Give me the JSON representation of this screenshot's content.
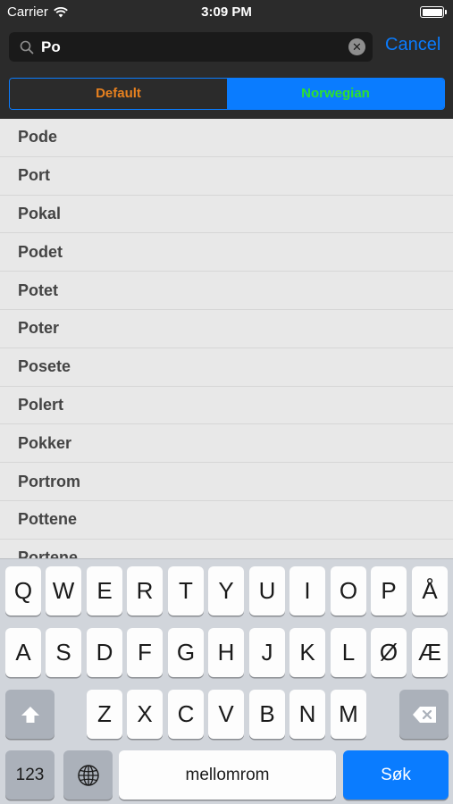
{
  "status_bar": {
    "carrier": "Carrier",
    "time": "3:09 PM"
  },
  "search": {
    "query": "Po",
    "cancel_label": "Cancel"
  },
  "segments": {
    "default_label": "Default",
    "norwegian_label": "Norwegian",
    "selected": "Norwegian"
  },
  "results": [
    "Pode",
    "Port",
    "Pokal",
    "Podet",
    "Potet",
    "Poter",
    "Posete",
    "Polert",
    "Pokker",
    "Portrom",
    "Pottene",
    "Portene"
  ],
  "keyboard": {
    "row1": [
      "Q",
      "W",
      "E",
      "R",
      "T",
      "Y",
      "U",
      "I",
      "O",
      "P",
      "Å"
    ],
    "row2": [
      "A",
      "S",
      "D",
      "F",
      "G",
      "H",
      "J",
      "K",
      "L",
      "Ø",
      "Æ"
    ],
    "row3": [
      "Z",
      "X",
      "C",
      "V",
      "B",
      "N",
      "M"
    ],
    "numbers_label": "123",
    "space_label": "mellomrom",
    "search_label": "Søk"
  },
  "colors": {
    "accent": "#0a7cff",
    "default_segment_text": "#e8811f",
    "norwegian_segment_text": "#2ee02e",
    "header_bg": "#2b2b2b"
  }
}
